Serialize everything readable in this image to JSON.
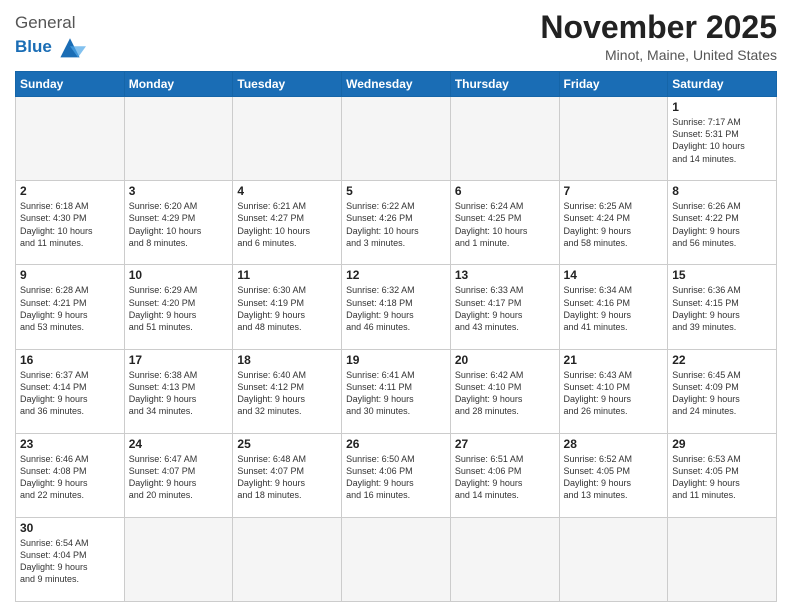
{
  "header": {
    "logo_general": "General",
    "logo_blue": "Blue",
    "month_title": "November 2025",
    "location": "Minot, Maine, United States"
  },
  "weekdays": [
    "Sunday",
    "Monday",
    "Tuesday",
    "Wednesday",
    "Thursday",
    "Friday",
    "Saturday"
  ],
  "weeks": [
    [
      {
        "day": "",
        "info": ""
      },
      {
        "day": "",
        "info": ""
      },
      {
        "day": "",
        "info": ""
      },
      {
        "day": "",
        "info": ""
      },
      {
        "day": "",
        "info": ""
      },
      {
        "day": "",
        "info": ""
      },
      {
        "day": "1",
        "info": "Sunrise: 7:17 AM\nSunset: 5:31 PM\nDaylight: 10 hours\nand 14 minutes."
      }
    ],
    [
      {
        "day": "2",
        "info": "Sunrise: 6:18 AM\nSunset: 4:30 PM\nDaylight: 10 hours\nand 11 minutes."
      },
      {
        "day": "3",
        "info": "Sunrise: 6:20 AM\nSunset: 4:29 PM\nDaylight: 10 hours\nand 8 minutes."
      },
      {
        "day": "4",
        "info": "Sunrise: 6:21 AM\nSunset: 4:27 PM\nDaylight: 10 hours\nand 6 minutes."
      },
      {
        "day": "5",
        "info": "Sunrise: 6:22 AM\nSunset: 4:26 PM\nDaylight: 10 hours\nand 3 minutes."
      },
      {
        "day": "6",
        "info": "Sunrise: 6:24 AM\nSunset: 4:25 PM\nDaylight: 10 hours\nand 1 minute."
      },
      {
        "day": "7",
        "info": "Sunrise: 6:25 AM\nSunset: 4:24 PM\nDaylight: 9 hours\nand 58 minutes."
      },
      {
        "day": "8",
        "info": "Sunrise: 6:26 AM\nSunset: 4:22 PM\nDaylight: 9 hours\nand 56 minutes."
      }
    ],
    [
      {
        "day": "9",
        "info": "Sunrise: 6:28 AM\nSunset: 4:21 PM\nDaylight: 9 hours\nand 53 minutes."
      },
      {
        "day": "10",
        "info": "Sunrise: 6:29 AM\nSunset: 4:20 PM\nDaylight: 9 hours\nand 51 minutes."
      },
      {
        "day": "11",
        "info": "Sunrise: 6:30 AM\nSunset: 4:19 PM\nDaylight: 9 hours\nand 48 minutes."
      },
      {
        "day": "12",
        "info": "Sunrise: 6:32 AM\nSunset: 4:18 PM\nDaylight: 9 hours\nand 46 minutes."
      },
      {
        "day": "13",
        "info": "Sunrise: 6:33 AM\nSunset: 4:17 PM\nDaylight: 9 hours\nand 43 minutes."
      },
      {
        "day": "14",
        "info": "Sunrise: 6:34 AM\nSunset: 4:16 PM\nDaylight: 9 hours\nand 41 minutes."
      },
      {
        "day": "15",
        "info": "Sunrise: 6:36 AM\nSunset: 4:15 PM\nDaylight: 9 hours\nand 39 minutes."
      }
    ],
    [
      {
        "day": "16",
        "info": "Sunrise: 6:37 AM\nSunset: 4:14 PM\nDaylight: 9 hours\nand 36 minutes."
      },
      {
        "day": "17",
        "info": "Sunrise: 6:38 AM\nSunset: 4:13 PM\nDaylight: 9 hours\nand 34 minutes."
      },
      {
        "day": "18",
        "info": "Sunrise: 6:40 AM\nSunset: 4:12 PM\nDaylight: 9 hours\nand 32 minutes."
      },
      {
        "day": "19",
        "info": "Sunrise: 6:41 AM\nSunset: 4:11 PM\nDaylight: 9 hours\nand 30 minutes."
      },
      {
        "day": "20",
        "info": "Sunrise: 6:42 AM\nSunset: 4:10 PM\nDaylight: 9 hours\nand 28 minutes."
      },
      {
        "day": "21",
        "info": "Sunrise: 6:43 AM\nSunset: 4:10 PM\nDaylight: 9 hours\nand 26 minutes."
      },
      {
        "day": "22",
        "info": "Sunrise: 6:45 AM\nSunset: 4:09 PM\nDaylight: 9 hours\nand 24 minutes."
      }
    ],
    [
      {
        "day": "23",
        "info": "Sunrise: 6:46 AM\nSunset: 4:08 PM\nDaylight: 9 hours\nand 22 minutes."
      },
      {
        "day": "24",
        "info": "Sunrise: 6:47 AM\nSunset: 4:07 PM\nDaylight: 9 hours\nand 20 minutes."
      },
      {
        "day": "25",
        "info": "Sunrise: 6:48 AM\nSunset: 4:07 PM\nDaylight: 9 hours\nand 18 minutes."
      },
      {
        "day": "26",
        "info": "Sunrise: 6:50 AM\nSunset: 4:06 PM\nDaylight: 9 hours\nand 16 minutes."
      },
      {
        "day": "27",
        "info": "Sunrise: 6:51 AM\nSunset: 4:06 PM\nDaylight: 9 hours\nand 14 minutes."
      },
      {
        "day": "28",
        "info": "Sunrise: 6:52 AM\nSunset: 4:05 PM\nDaylight: 9 hours\nand 13 minutes."
      },
      {
        "day": "29",
        "info": "Sunrise: 6:53 AM\nSunset: 4:05 PM\nDaylight: 9 hours\nand 11 minutes."
      }
    ],
    [
      {
        "day": "30",
        "info": "Sunrise: 6:54 AM\nSunset: 4:04 PM\nDaylight: 9 hours\nand 9 minutes."
      },
      {
        "day": "",
        "info": ""
      },
      {
        "day": "",
        "info": ""
      },
      {
        "day": "",
        "info": ""
      },
      {
        "day": "",
        "info": ""
      },
      {
        "day": "",
        "info": ""
      },
      {
        "day": "",
        "info": ""
      }
    ]
  ]
}
